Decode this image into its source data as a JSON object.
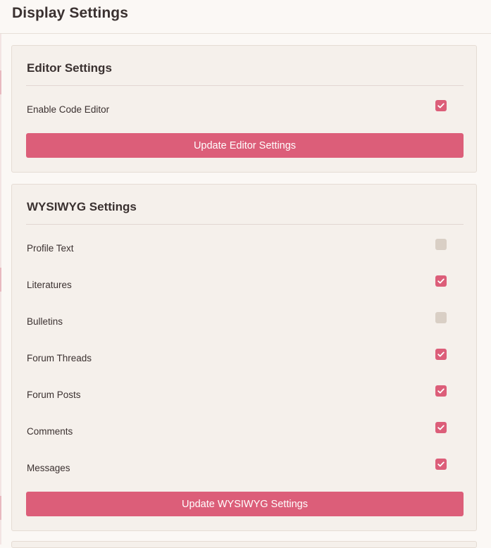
{
  "page": {
    "title": "Display Settings"
  },
  "editor_settings": {
    "title": "Editor Settings",
    "rows": [
      {
        "label": "Enable Code Editor",
        "checked": true
      }
    ],
    "button_label": "Update Editor Settings"
  },
  "wysiwyg_settings": {
    "title": "WYSIWYG Settings",
    "rows": [
      {
        "label": "Profile Text",
        "checked": false
      },
      {
        "label": "Literatures",
        "checked": true
      },
      {
        "label": "Bulletins",
        "checked": false
      },
      {
        "label": "Forum Threads",
        "checked": true
      },
      {
        "label": "Forum Posts",
        "checked": true
      },
      {
        "label": "Comments",
        "checked": true
      },
      {
        "label": "Messages",
        "checked": true
      }
    ],
    "button_label": "Update WYSIWYG Settings"
  },
  "colors": {
    "accent": "#dc5e79",
    "background": "#fbf8f5",
    "card": "#f5f0eb",
    "unchecked": "#d9cfc5"
  },
  "icons": {
    "check": "checkmark-icon"
  }
}
